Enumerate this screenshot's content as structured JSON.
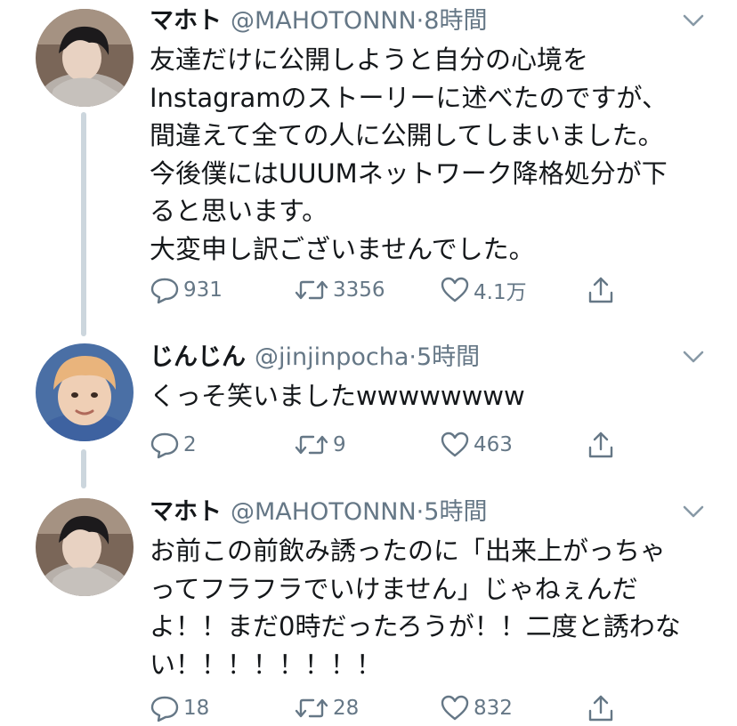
{
  "tweets": [
    {
      "name": "マホト",
      "handle": "@MAHOTONNN",
      "dot": "·",
      "time": "8時間",
      "avatar_icon": "user-avatar-dark-hair",
      "lines": [
        "友達だけに公開しようと自分の心境を",
        "Instagramのストーリーに述べたのですが、",
        "間違えて全ての人に公開してしまいました。",
        "今後僕にはUUUMネットワーク降格処分が下",
        "ると思います。",
        "大変申し訳ございませんでした。"
      ],
      "replies": "931",
      "retweets": "3356",
      "likes": "4.1万"
    },
    {
      "name": "じんじん",
      "handle": "@jinjinpocha",
      "dot": "·",
      "time": "5時間",
      "avatar_icon": "user-avatar-blond-hair",
      "lines": [
        "くっそ笑いましたwwwwwwww"
      ],
      "replies": "2",
      "retweets": "9",
      "likes": "463"
    },
    {
      "name": "マホト",
      "handle": "@MAHOTONNN",
      "dot": "·",
      "time": "5時間",
      "avatar_icon": "user-avatar-dark-hair",
      "lines": [
        "お前この前飲み誘ったのに「出来上がっちゃ",
        "ってフラフラでいけません」じゃねぇんだ",
        "よ！！まだ0時だったろうが！！二度と誘わな",
        "い！！！！！！！！"
      ],
      "replies": "18",
      "retweets": "28",
      "likes": "832"
    }
  ],
  "colors": {
    "text": "#14171a",
    "secondary": "#657786",
    "thread_line": "#ccd6dd"
  }
}
